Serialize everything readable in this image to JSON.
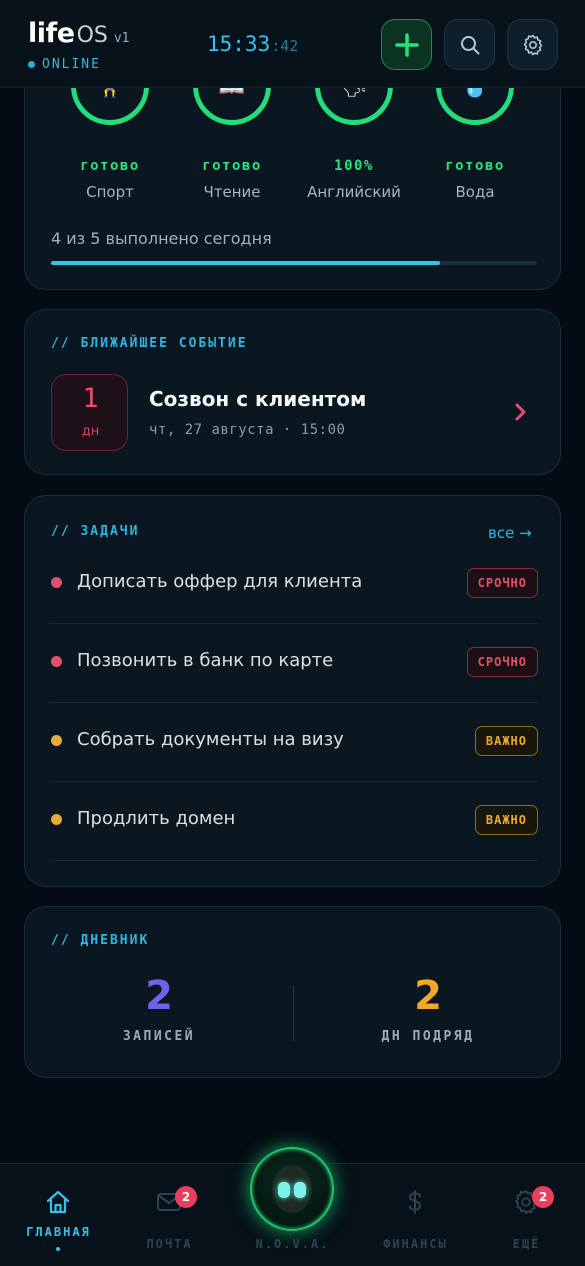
{
  "header": {
    "brand_life": "life",
    "brand_os": "OS",
    "brand_version": "v1",
    "status": "ONLINE",
    "clock_main": "15:33",
    "clock_seconds": ":42",
    "icons": [
      "plus-icon",
      "search-icon",
      "gear-icon"
    ]
  },
  "habits": {
    "items": [
      {
        "icon": "🏋",
        "status": "готово",
        "name": "Спорт"
      },
      {
        "icon": "📖",
        "status": "готово",
        "name": "Чтение"
      },
      {
        "icon": "🗣",
        "status": "100%",
        "name": "Английский"
      },
      {
        "icon": "💧",
        "status": "готово",
        "name": "Вода"
      }
    ],
    "summary": "4 из 5 выполнено сегодня",
    "progress": 0.8
  },
  "event": {
    "section": "// БЛИЖАЙШЕЕ СОБЫТИЕ",
    "day": "1",
    "unit": "дн",
    "title": "Созвон с клиентом",
    "subtitle": "чт, 27 августа · 15:00"
  },
  "tasks": {
    "section": "// ЗАДАЧИ",
    "all_link": "все →",
    "items": [
      {
        "title": "Дописать оффер для клиента",
        "badge": "СРОЧНО",
        "level": "urgent"
      },
      {
        "title": "Позвонить в банк по карте",
        "badge": "СРОЧНО",
        "level": "urgent"
      },
      {
        "title": "Собрать документы на визу",
        "badge": "ВАЖНО",
        "level": "important"
      },
      {
        "title": "Продлить домен",
        "badge": "ВАЖНО",
        "level": "important"
      }
    ]
  },
  "diary": {
    "section": "// ДНЕВНИК",
    "entries_value": "2",
    "entries_label": "ЗАПИСЕЙ",
    "streak_value": "2",
    "streak_label": "ДН ПОДРЯД"
  },
  "nav": {
    "home": "ГЛАВНАЯ",
    "mail": "ПОЧТА",
    "mail_badge": "2",
    "nova": "N.O.V.A.",
    "finance": "ФИНАНСЫ",
    "more": "ЕЩЁ",
    "more_badge": "2"
  },
  "colors": {
    "accent": "#2fb5e0",
    "success": "#22dd7a",
    "urgent": "#e4506c",
    "important": "#e9a93b",
    "diary_entries": "#6c63e8",
    "diary_streak": "#f0a826"
  }
}
